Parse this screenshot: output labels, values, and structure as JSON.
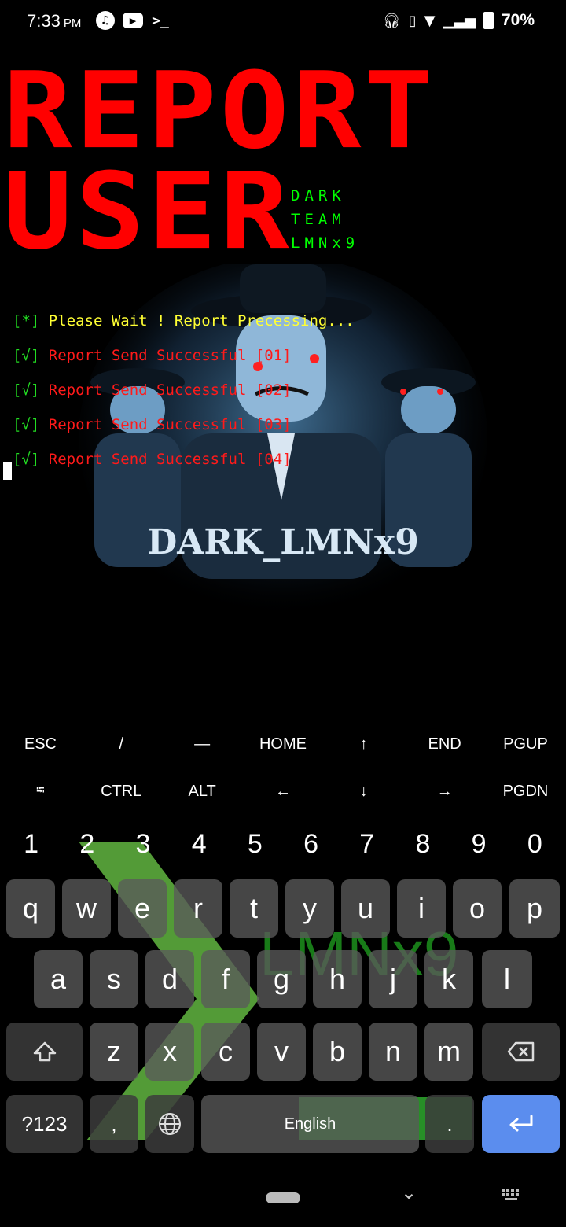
{
  "status_bar": {
    "time": "7:33",
    "ampm": "PM",
    "app_icons": [
      "music-app-icon",
      "youtube-icon",
      "terminal-icon"
    ],
    "battery": "70%"
  },
  "terminal": {
    "banner": {
      "line1": "REPORT",
      "line2": "USER",
      "team": [
        "DARK",
        "TEAM",
        "LMNx9"
      ]
    },
    "background_caption": "DARK_LMNx9",
    "log": [
      {
        "tag": "[*]",
        "text": " Please Wait ! Report Precessing...",
        "kind": "wait"
      },
      {
        "tag": "[√]",
        "text": " Report Send Successful [01]",
        "kind": "ok"
      },
      {
        "tag": "[√]",
        "text": " Report Send Successful [02]",
        "kind": "ok"
      },
      {
        "tag": "[√]",
        "text": " Report Send Successful [03]",
        "kind": "ok"
      },
      {
        "tag": "[√]",
        "text": " Report Send Successful [04]",
        "kind": "ok"
      }
    ]
  },
  "extra_keys": {
    "row1": [
      "ESC",
      "/",
      "—",
      "HOME",
      "↑",
      "END",
      "PGUP"
    ],
    "row2": [
      "⭾",
      "CTRL",
      "ALT",
      "←",
      "↓",
      "→",
      "PGDN"
    ]
  },
  "keyboard": {
    "numbers": [
      "1",
      "2",
      "3",
      "4",
      "5",
      "6",
      "7",
      "8",
      "9",
      "0"
    ],
    "row1": [
      "q",
      "w",
      "e",
      "r",
      "t",
      "y",
      "u",
      "i",
      "o",
      "p"
    ],
    "row2": [
      "a",
      "s",
      "d",
      "f",
      "g",
      "h",
      "j",
      "k",
      "l"
    ],
    "row3": [
      "z",
      "x",
      "c",
      "v",
      "b",
      "n",
      "m"
    ],
    "symbols_label": "?123",
    "comma": ",",
    "space_label": "English",
    "period": ".",
    "watermark": "LMNx9"
  },
  "colors": {
    "banner_red": "#ff0000",
    "team_green": "#00ff00",
    "wait_yellow": "#ffff33",
    "enter_blue": "#5b8dee"
  }
}
